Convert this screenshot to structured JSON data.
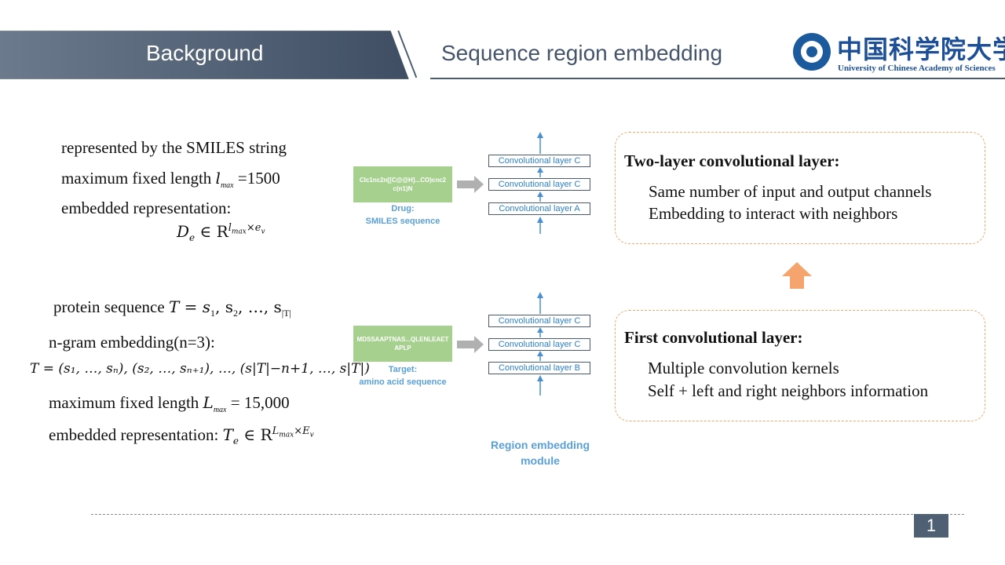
{
  "header": {
    "left_title": "Background",
    "right_title": "Sequence region embedding",
    "logo_cn": "中国科学院大学",
    "logo_en": "University of Chinese Academy of Sciences",
    "band_color": "#4b5b70"
  },
  "drug": {
    "line1": "represented by the SMILES string",
    "line2_pre": "maximum fixed length ",
    "line2_var": "l",
    "line2_sub": "max",
    "line2_post": " =1500",
    "line3": "embedded representation:",
    "formula_lhs": "D",
    "formula_lhs_sub": "e",
    "formula_in": " ∈ R",
    "formula_sup_l": "l",
    "formula_sup_sub": "max",
    "formula_sup_rest": "×e",
    "formula_sup_rest_sub": "v"
  },
  "protein": {
    "line1_pre": "protein sequence ",
    "line1_math": "T = s",
    "line1_rest": ", s",
    "line1_tail": ", …, s",
    "sub1": "1",
    "sub2": "2",
    "sub3": "|T|",
    "line2": "n-gram embedding(n=3):",
    "ngram_formula": "T = (s₁, …, sₙ), (s₂, …, sₙ₊₁), …, (s|T|−n+1, …, s|T|)",
    "line4_pre": "maximum fixed length ",
    "line4_var": "L",
    "line4_sub": "max",
    "line4_post": " = 15,000",
    "line5": "embedded representation:",
    "formula_lhs": "T",
    "formula_lhs_sub": "e",
    "formula_in": " ∈ R",
    "formula_sup_l": "L",
    "formula_sup_sub": "max",
    "formula_sup_rest": "×E",
    "formula_sup_rest_sub": "v"
  },
  "diagram": {
    "drug_input": "Clc1nc2n[[C@@H]...CO)cnc2\nc(n1)N",
    "drug_caption_1": "Drug:",
    "drug_caption_2": "SMILES sequence",
    "drug_layers": [
      "Convolutional layer C",
      "Convolutional layer C",
      "Convolutional layer A"
    ],
    "target_input": "MDSSAAPTNAS...QLENLEAET\nAPLP",
    "target_caption_1": "Target:",
    "target_caption_2": "amino acid sequence",
    "target_layers": [
      "Convolutional layer C",
      "Convolutional layer C",
      "Convolutional layer B"
    ],
    "module_caption_1": "Region embedding",
    "module_caption_2": "module",
    "accent": "#5aa0d6"
  },
  "box_top": {
    "heading": "Two-layer convolutional layer:",
    "lines": [
      "Same number of input and output channels",
      "Embedding to interact with neighbors"
    ]
  },
  "box_bottom": {
    "heading": "First convolutional layer:",
    "lines": [
      "Multiple convolution kernels",
      "Self + left and right neighbors information"
    ]
  },
  "arrow_color": "#f4a46c",
  "page_number": "1"
}
